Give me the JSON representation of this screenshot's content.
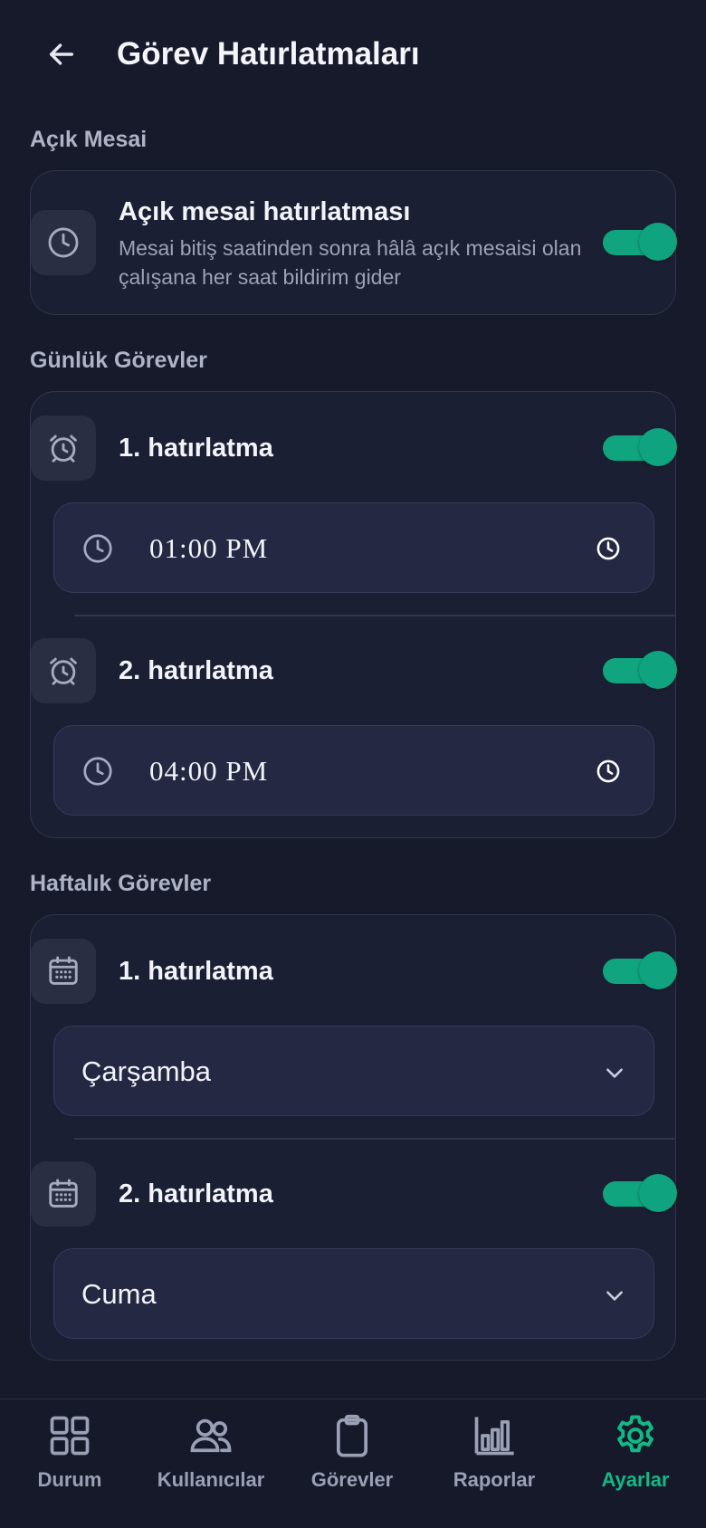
{
  "header": {
    "title": "Görev Hatırlatmaları"
  },
  "sections": {
    "overtime": {
      "label": "Açık Mesai",
      "row": {
        "title": "Açık mesai hatırlatması",
        "description": "Mesai bitiş saatinden sonra hâlâ açık mesaisi olan çalışana her saat bildirim gider",
        "enabled": true
      }
    },
    "daily": {
      "label": "Günlük Görevler",
      "reminders": [
        {
          "title": "1. hatırlatma",
          "time": "01:00 PM",
          "enabled": true
        },
        {
          "title": "2. hatırlatma",
          "time": "04:00 PM",
          "enabled": true
        }
      ]
    },
    "weekly": {
      "label": "Haftalık Görevler",
      "reminders": [
        {
          "title": "1. hatırlatma",
          "day": "Çarşamba",
          "enabled": true
        },
        {
          "title": "2. hatırlatma",
          "day": "Cuma",
          "enabled": true
        }
      ]
    }
  },
  "nav": {
    "items": [
      {
        "label": "Durum",
        "icon": "grid-icon",
        "active": false
      },
      {
        "label": "Kullanıcılar",
        "icon": "users-icon",
        "active": false
      },
      {
        "label": "Görevler",
        "icon": "clipboard-icon",
        "active": false
      },
      {
        "label": "Raporlar",
        "icon": "bar-chart-icon",
        "active": false
      },
      {
        "label": "Ayarlar",
        "icon": "gear-icon",
        "active": true
      }
    ]
  },
  "colors": {
    "background": "#171a2b",
    "card": "#1b1f33",
    "accent": "#12b886",
    "toggle_on": "#10a57e"
  }
}
